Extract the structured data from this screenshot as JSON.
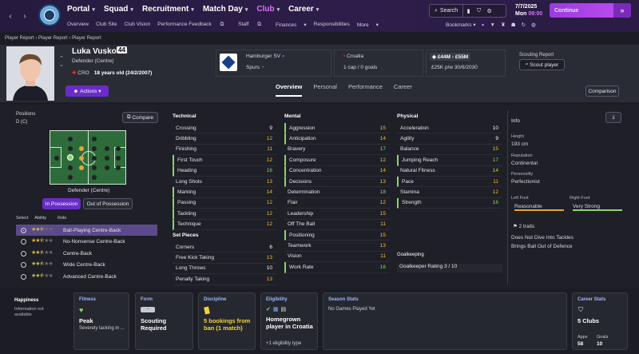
{
  "nav": {
    "menus": [
      "Portal",
      "Squad",
      "Recruitment",
      "Match Day",
      "Club",
      "Career"
    ],
    "active": "Club",
    "submenu": [
      "Overview",
      "Club Site",
      "Club Vision",
      "Performance Feedback",
      "Staff",
      "Finances",
      "Responsibilities",
      "More"
    ],
    "search": "Search",
    "date": "7/7/2025",
    "day_time": "Mon",
    "time": "09:00",
    "continue": "Continue",
    "bookmarks": "Bookmarks"
  },
  "breadcrumb": [
    "Player Report",
    "Player Report",
    "Player Report"
  ],
  "player": {
    "name": "Luka Vusković",
    "number": "44",
    "position": "Defender (Centre)",
    "nation_code": "CRO",
    "age": "18 years old (24/2/2007)",
    "club": "Hamburger SV",
    "loan_club": "Spurs",
    "nation": "Croatia",
    "caps": "1 cap / 0 goals",
    "value": "£44M - £55M",
    "wage": "£25K p/w 30/6/2030",
    "actions": "Actions"
  },
  "scouting": {
    "label": "Scouting Report",
    "button": "Scout player"
  },
  "tabs": [
    "Overview",
    "Personal",
    "Performance",
    "Career"
  ],
  "comparison": "Comparison",
  "positions": {
    "label": "Positions",
    "sub": "D (C)",
    "compare": "Compare",
    "role": "Defender (Centre)",
    "in_possession": "In Possession",
    "out_possession": "Out of Possession",
    "cols": [
      "Select",
      "Ability",
      "Role"
    ],
    "roles": [
      {
        "name": "Ball-Playing Centre-Back",
        "stars": 2.5
      },
      {
        "name": "No-Nonsense Centre-Back",
        "stars": 2.5
      },
      {
        "name": "Centre-Back",
        "stars": 2.5
      },
      {
        "name": "Wide Centre-Back",
        "stars": 2.5
      },
      {
        "name": "Advanced Centre-Back",
        "stars": 2.5
      }
    ]
  },
  "technical": {
    "title": "Technical",
    "rows": [
      [
        "Crossing",
        "9"
      ],
      [
        "Dribbling",
        "12"
      ],
      [
        "Finishing",
        "11"
      ],
      [
        "First Touch",
        "12"
      ],
      [
        "Heading",
        "16"
      ],
      [
        "Long Shots",
        "13"
      ],
      [
        "Marking",
        "14"
      ],
      [
        "Passing",
        "12"
      ],
      [
        "Tackling",
        "12"
      ],
      [
        "Technique",
        "12"
      ]
    ]
  },
  "set_pieces": {
    "title": "Set Pieces",
    "rows": [
      [
        "Corners",
        "6"
      ],
      [
        "Free Kick Taking",
        "13"
      ],
      [
        "Long Throws",
        "10"
      ],
      [
        "Penalty Taking",
        "13"
      ]
    ]
  },
  "mental": {
    "title": "Mental",
    "rows": [
      [
        "Aggression",
        "15"
      ],
      [
        "Anticipation",
        "14"
      ],
      [
        "Bravery",
        "17"
      ],
      [
        "Composure",
        "12"
      ],
      [
        "Concentration",
        "14"
      ],
      [
        "Decisions",
        "13"
      ],
      [
        "Determination",
        "18"
      ],
      [
        "Flair",
        "12"
      ],
      [
        "Leadership",
        "15"
      ],
      [
        "Off The Ball",
        "11"
      ],
      [
        "Positioning",
        "15"
      ],
      [
        "Teamwork",
        "13"
      ],
      [
        "Vision",
        "11"
      ],
      [
        "Work Rate",
        "16"
      ]
    ]
  },
  "physical": {
    "title": "Physical",
    "rows": [
      [
        "Acceleration",
        "10"
      ],
      [
        "Agility",
        "9"
      ],
      [
        "Balance",
        "15"
      ],
      [
        "Jumping Reach",
        "17"
      ],
      [
        "Natural Fitness",
        "14"
      ],
      [
        "Pace",
        "11"
      ],
      [
        "Stamina",
        "12"
      ],
      [
        "Strength",
        "16"
      ]
    ]
  },
  "goalkeeping": {
    "title": "Goalkeeping",
    "rating": "Goalkeeper Rating 3 / 10"
  },
  "info": {
    "title": "Info",
    "height_l": "Height",
    "height": "193 cm",
    "rep_l": "Reputation",
    "rep": "Continental",
    "pers_l": "Personality",
    "pers": "Perfectionist",
    "lf_l": "Left Foot",
    "lf": "Reasonable",
    "rf_l": "Right Foot",
    "rf": "Very Strong",
    "traits": "2 traits",
    "trait1": "Does Not Dive Into Tackles",
    "trait2": "Brings Ball Out of Defence"
  },
  "bottom": {
    "happiness": "Happiness",
    "happiness_sub": "Information not available",
    "fitness": "Fitness",
    "fitness_v": "Peak",
    "fitness_s": "Severely lacking in ...",
    "form": "Form",
    "form_v": "Scouting Required",
    "discipline": "Discipline",
    "discipline_v": "5 bookings from ban (1 match)",
    "eligibility": "Eligibility",
    "eligibility_v": "Homegrown player in Croatia",
    "eligibility_s": "+1 eligibility type",
    "season": "Season Stats",
    "season_v": "No Games Played Yet",
    "career": "Career Stats",
    "career_v": "5 Clubs",
    "apps_l": "Apps",
    "apps": "58",
    "goals_l": "Goals",
    "goals": "10"
  }
}
